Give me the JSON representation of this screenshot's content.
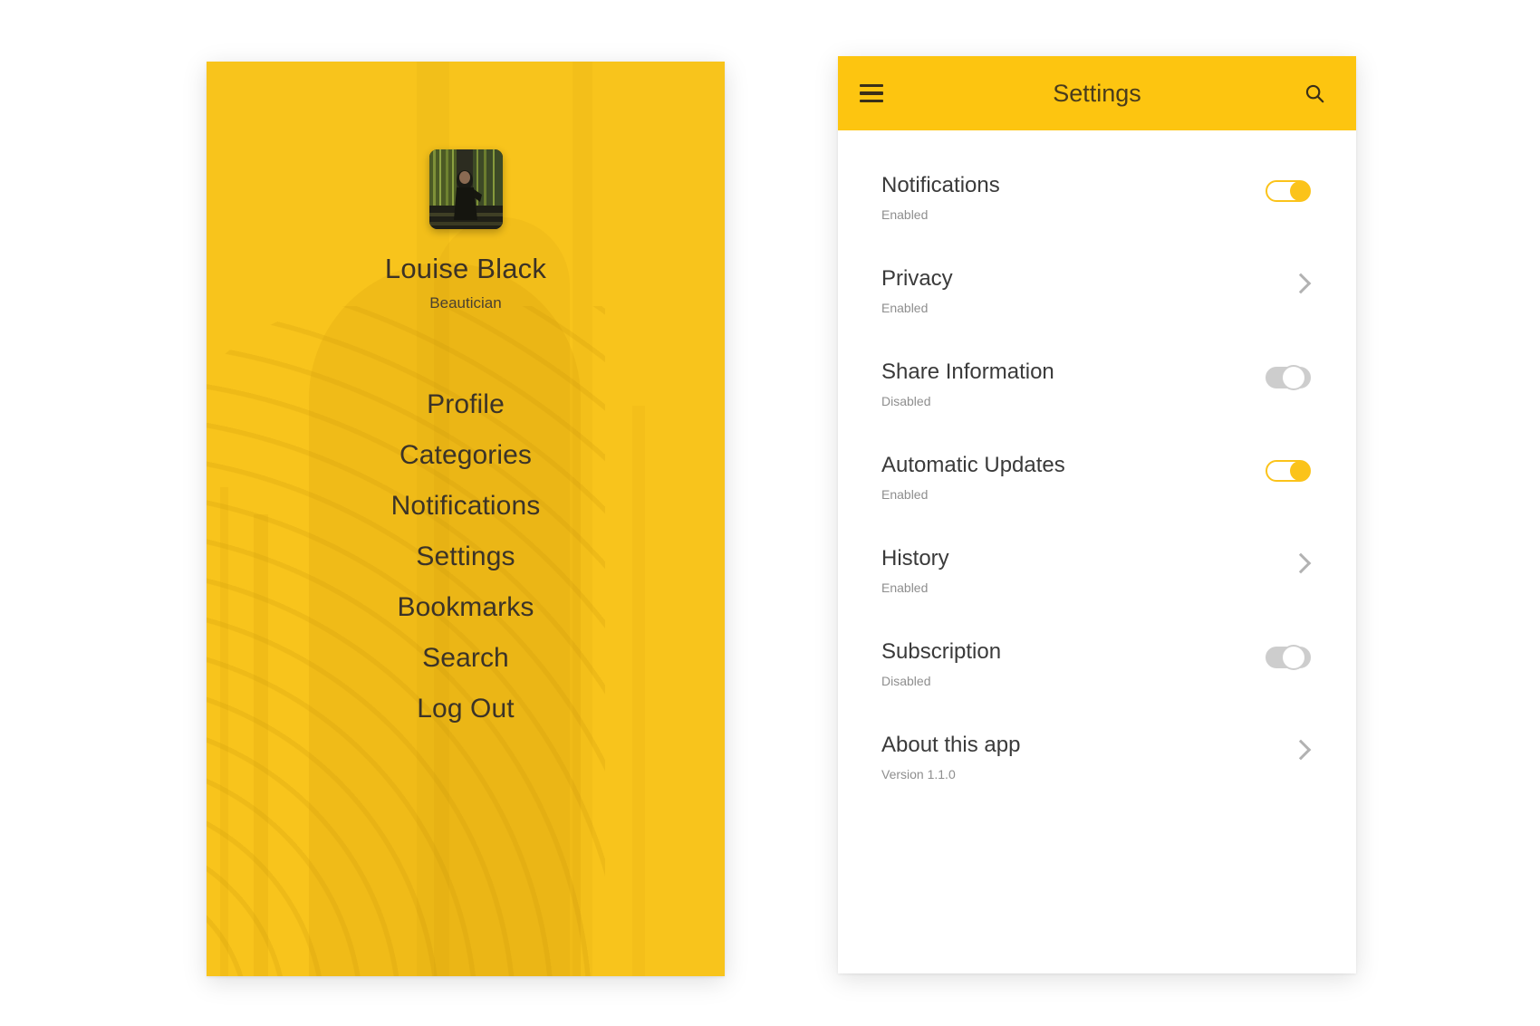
{
  "drawer": {
    "profile": {
      "name": "Louise Black",
      "role": "Beautician",
      "avatar_icon": "user-photo-avatar"
    },
    "menu_items": [
      {
        "label": "Profile"
      },
      {
        "label": "Categories"
      },
      {
        "label": "Notifications"
      },
      {
        "label": "Settings"
      },
      {
        "label": "Bookmarks"
      },
      {
        "label": "Search"
      },
      {
        "label": "Log Out"
      }
    ]
  },
  "settings": {
    "appbar": {
      "menu_icon": "hamburger-icon",
      "title": "Settings",
      "search_icon": "search-icon"
    },
    "rows": [
      {
        "label": "Notifications",
        "sub": "Enabled",
        "control": "toggle",
        "state": "on"
      },
      {
        "label": "Privacy",
        "sub": "Enabled",
        "control": "chevron",
        "state": ""
      },
      {
        "label": "Share Information",
        "sub": "Disabled",
        "control": "toggle",
        "state": "off"
      },
      {
        "label": "Automatic Updates",
        "sub": "Enabled",
        "control": "toggle",
        "state": "on"
      },
      {
        "label": "History",
        "sub": "Enabled",
        "control": "chevron",
        "state": ""
      },
      {
        "label": "Subscription",
        "sub": "Disabled",
        "control": "toggle",
        "state": "off"
      },
      {
        "label": "About this app",
        "sub": "Version 1.1.0",
        "control": "chevron",
        "state": ""
      }
    ]
  },
  "colors": {
    "drawer_yellow": "#f8c41c",
    "appbar_yellow": "#fdc510",
    "toggle_on": "#fbc31a",
    "toggle_off": "#cdcdcd",
    "chevron_gray": "#b2b2b2",
    "page_background": "#ffffff",
    "label_dark": "#3a3a3a",
    "sub_gray": "#8e8e8e"
  }
}
